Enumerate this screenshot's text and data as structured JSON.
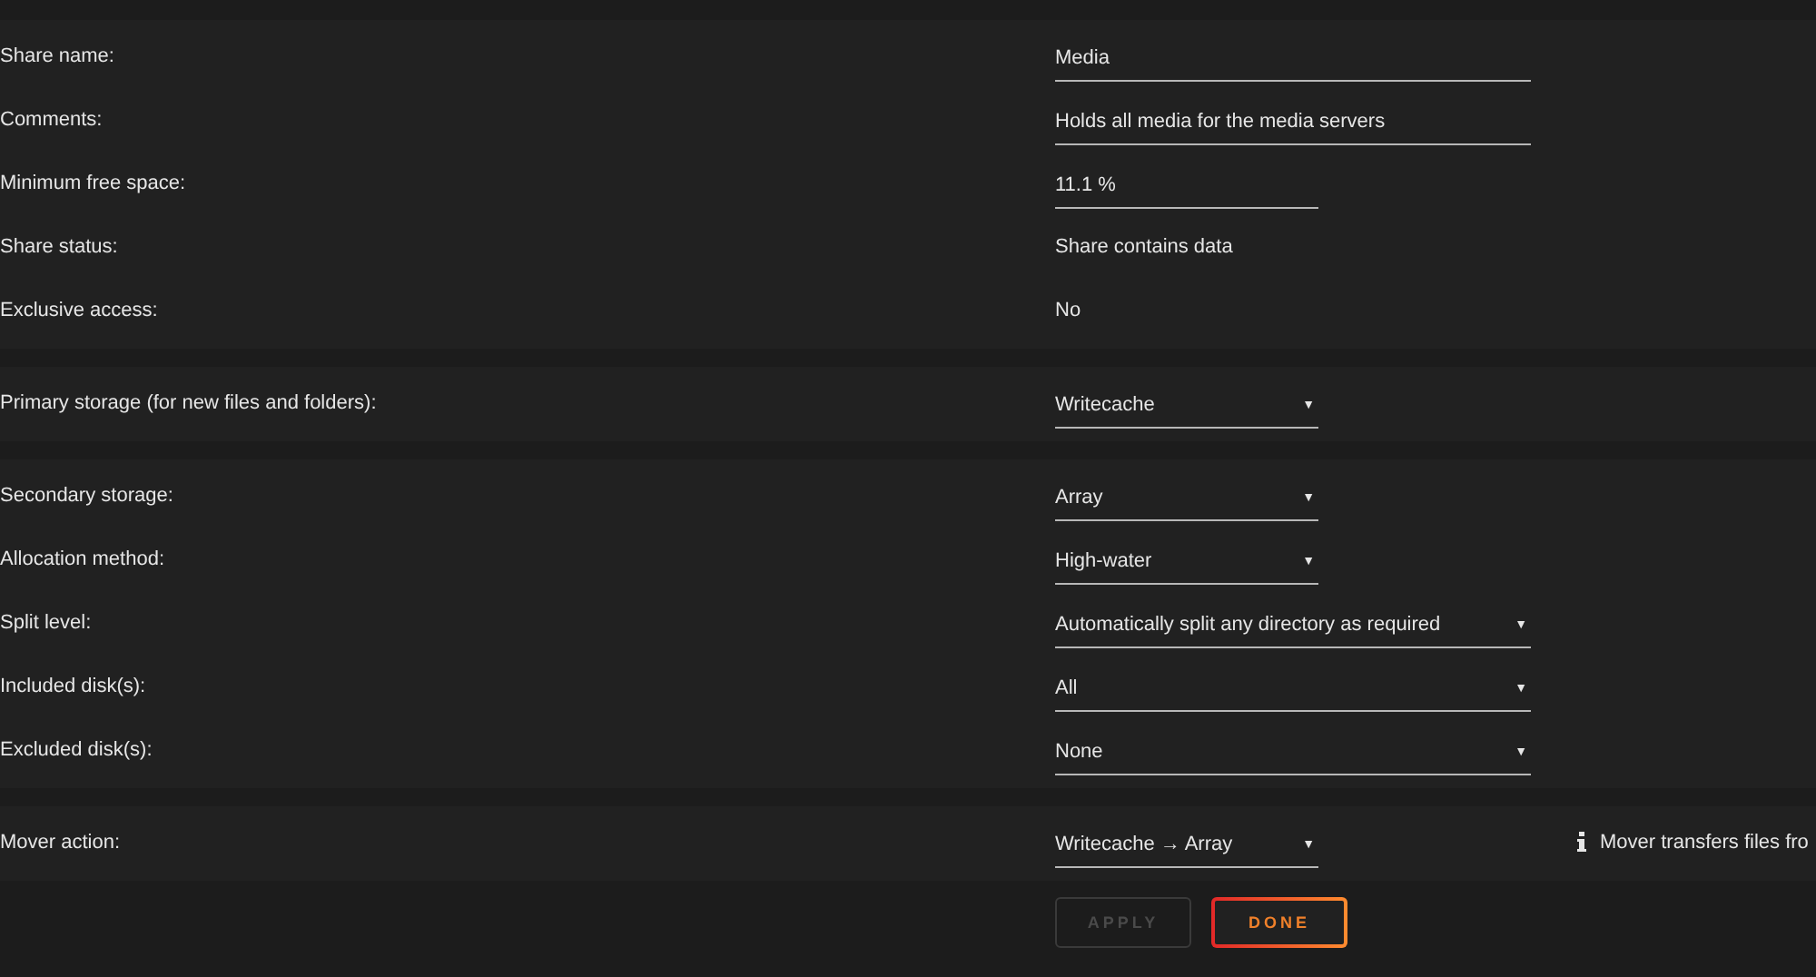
{
  "sections": [
    {
      "rows": [
        {
          "label": "Share name:",
          "kind": "text",
          "value": "Media"
        },
        {
          "label": "Comments:",
          "kind": "text",
          "value": "Holds all media for the media servers"
        },
        {
          "label": "Minimum free space:",
          "kind": "text",
          "value": "11.1 %"
        },
        {
          "label": "Share status:",
          "kind": "plain",
          "value": "Share contains data"
        },
        {
          "label": "Exclusive access:",
          "kind": "plain",
          "value": "No"
        }
      ]
    },
    {
      "rows": [
        {
          "label": "Primary storage (for new files and folders):",
          "kind": "select",
          "value": "Writecache",
          "caret": "▼"
        }
      ]
    },
    {
      "rows": [
        {
          "label": "Secondary storage:",
          "kind": "select",
          "value": "Array",
          "caret": "▼"
        },
        {
          "label": "Allocation method:",
          "kind": "select",
          "value": "High-water",
          "caret": "▼"
        },
        {
          "label": "Split level:",
          "kind": "select",
          "value": "Automatically split any directory as required",
          "caret": "▼"
        },
        {
          "label": "Included disk(s):",
          "kind": "select",
          "value": "All",
          "caret": "▼"
        },
        {
          "label": "Excluded disk(s):",
          "kind": "select",
          "value": "None",
          "caret": "▼"
        }
      ]
    },
    {
      "rows": [
        {
          "label": "Mover action:",
          "kind": "select",
          "value": "Writecache → Array",
          "caret": "▼",
          "note": "Mover transfers files fro"
        }
      ]
    }
  ],
  "buttons": [
    {
      "label": "APPLY",
      "disabled": true
    },
    {
      "label": "DONE",
      "disabled": false
    }
  ]
}
